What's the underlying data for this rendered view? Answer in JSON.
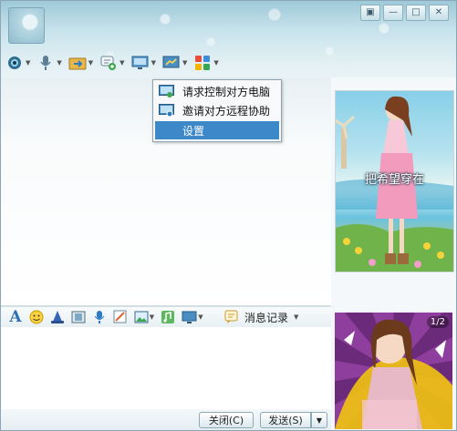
{
  "window": {
    "controls": [
      "settings",
      "minimize",
      "maximize",
      "close"
    ]
  },
  "toolbar": {
    "items": [
      {
        "icon": "webcam-icon"
      },
      {
        "icon": "microphone-icon"
      },
      {
        "icon": "file-transfer-icon"
      },
      {
        "icon": "chat-add-icon"
      },
      {
        "icon": "remote-desktop-icon"
      },
      {
        "icon": "share-screen-icon"
      },
      {
        "icon": "apps-icon"
      }
    ]
  },
  "menu": {
    "items": [
      {
        "label": "请求控制对方电脑",
        "icon": "remote-control-icon"
      },
      {
        "label": "邀请对方远程协助",
        "icon": "remote-assist-icon"
      },
      {
        "label": "设置",
        "selected": true
      }
    ]
  },
  "show_panel": {
    "caption": "把希望穿在"
  },
  "input_toolbar": {
    "message_history_label": "消息记录"
  },
  "avatar_panel": {
    "pager": "1/2"
  },
  "buttons": {
    "close_label": "关闭(C)",
    "send_label": "发送(S)"
  },
  "colors": {
    "selection": "#3d88c8",
    "header": "#9ec9d8"
  }
}
